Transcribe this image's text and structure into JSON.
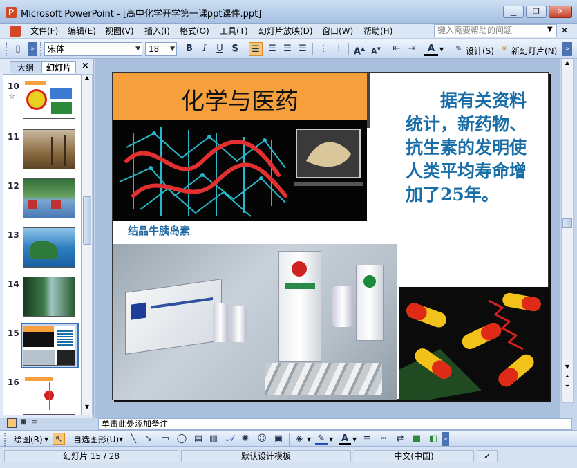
{
  "window": {
    "title": "Microsoft PowerPoint - [高中化学开学第一课ppt课件.ppt]",
    "app_icon": "powerpoint-icon",
    "controls": [
      "minimize",
      "restore",
      "close"
    ]
  },
  "menu": {
    "items": [
      "文件(F)",
      "编辑(E)",
      "视图(V)",
      "插入(I)",
      "格式(O)",
      "工具(T)",
      "幻灯片放映(D)",
      "窗口(W)",
      "帮助(H)"
    ],
    "help_placeholder": "键入需要帮助的问题"
  },
  "toolbar": {
    "font_name": "宋体",
    "font_size": "18",
    "bold": "B",
    "italic": "I",
    "underline": "U",
    "shadow": "S",
    "design_label": "设计(S)",
    "new_slide_label": "新幻灯片(N)",
    "font_color": "A"
  },
  "left_pane": {
    "tabs": [
      "大纲",
      "幻灯片"
    ],
    "active_tab": "幻灯片",
    "close_glyph": "×",
    "slide_numbers": [
      "10",
      "11",
      "12",
      "13",
      "14",
      "15",
      "16"
    ],
    "selected_slide": "15",
    "slide10_mark": "☆"
  },
  "slide": {
    "title": "化学与医药",
    "body": "据有关资料统计，新药物、抗生素的发明使人类平均寿命增加了25年。",
    "caption": "结晶牛胰岛素"
  },
  "notes": {
    "placeholder": "单击此处添加备注"
  },
  "drawing_toolbar": {
    "draw_label": "绘图(R)",
    "autoshapes_label": "自选图形(U)"
  },
  "status": {
    "slide_position": "幻灯片 15 / 28",
    "template": "默认设计模板",
    "language": "中文(中国)"
  },
  "colors": {
    "accent_orange": "#f5a03c",
    "body_text_blue": "#1a6ea8",
    "selection_blue": "#3d6fb5"
  }
}
